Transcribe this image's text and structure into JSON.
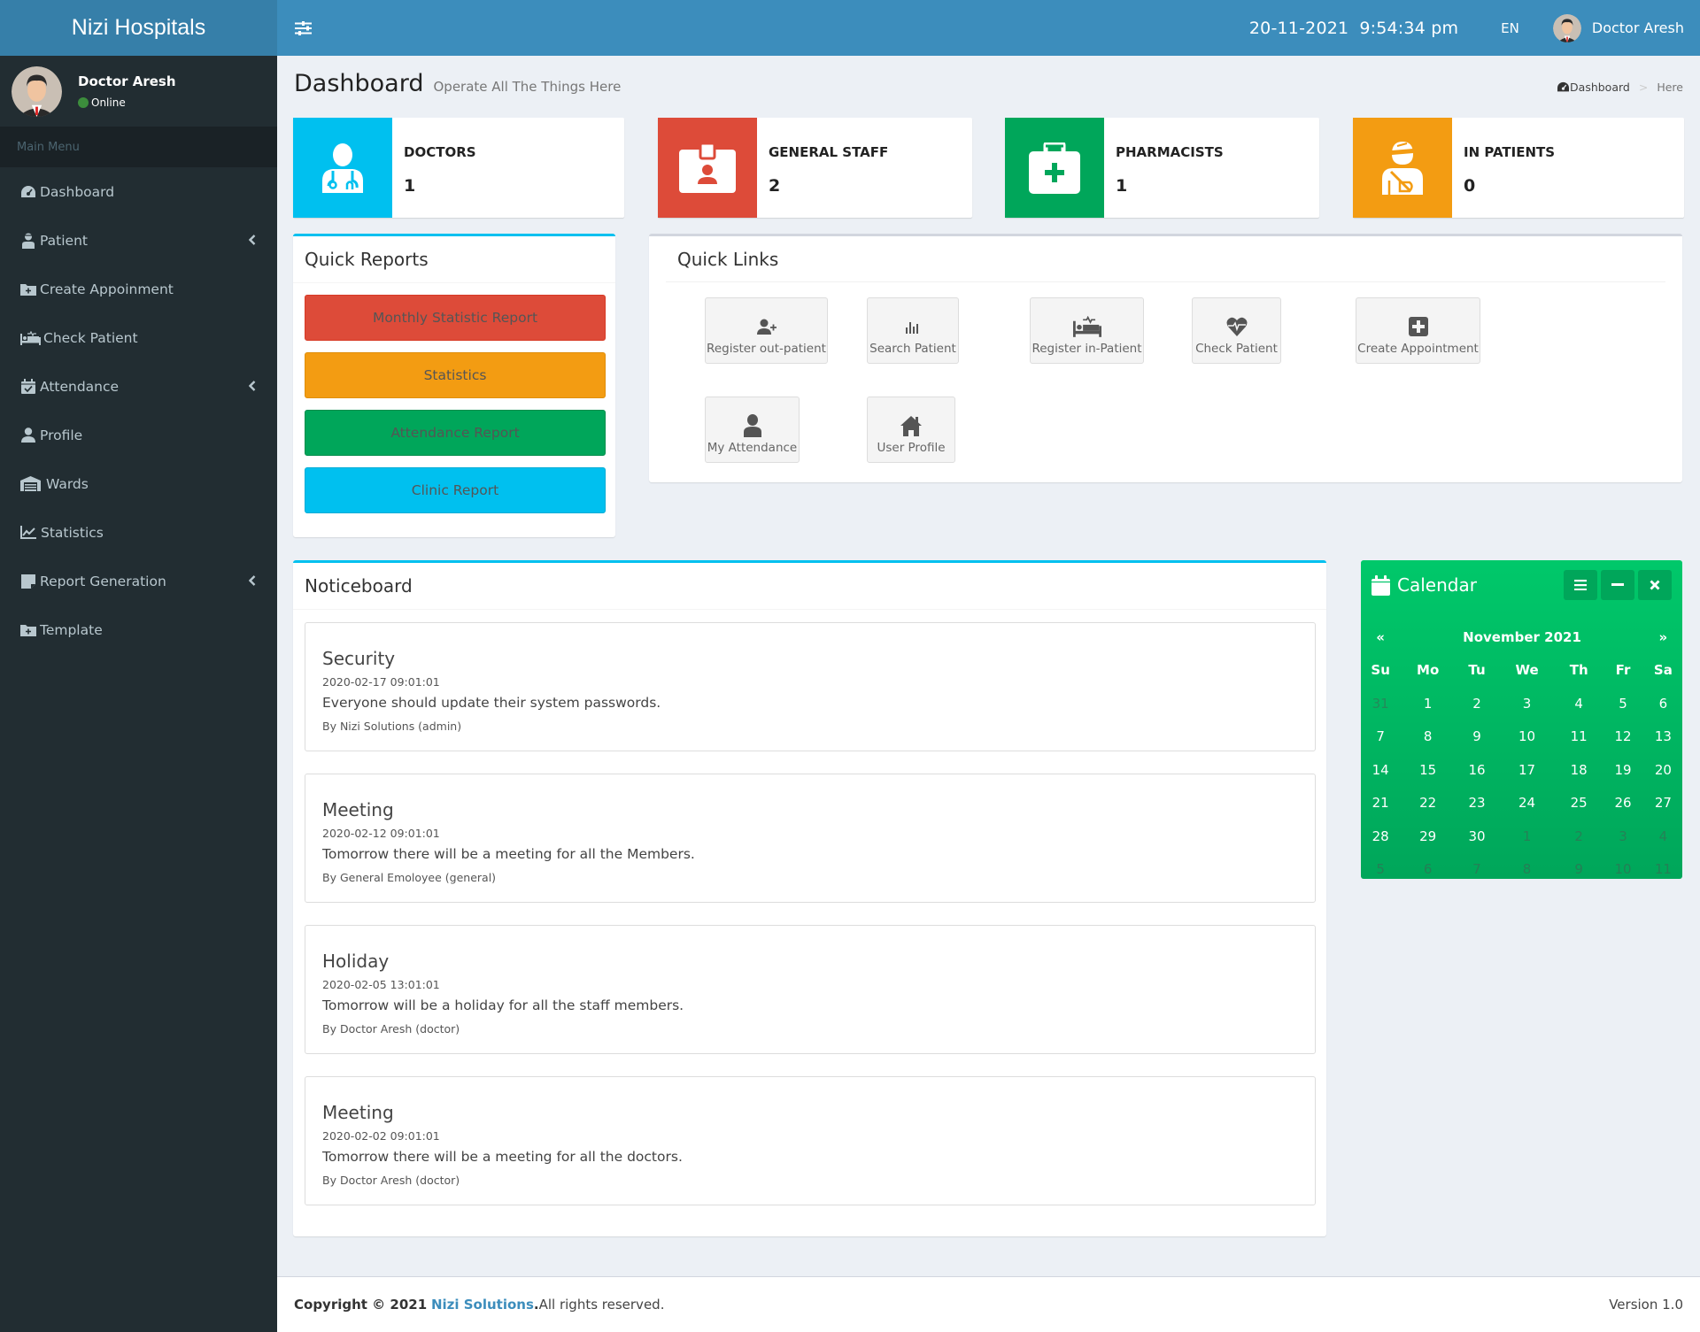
{
  "app": {
    "title": "Nizi Hospitals"
  },
  "header": {
    "date": "20-11-2021",
    "time": "9:54:34 pm",
    "language": "EN",
    "user_name": "Doctor Aresh"
  },
  "sidebar": {
    "user_name": "Doctor Aresh",
    "status": "Online",
    "menu_header": "Main Menu",
    "items": [
      {
        "label": "Dashboard",
        "icon": "dashboard-icon",
        "has_submenu": false
      },
      {
        "label": "Patient",
        "icon": "patient-icon",
        "has_submenu": true
      },
      {
        "label": "Create Appoinment",
        "icon": "folder-plus-icon",
        "has_submenu": false
      },
      {
        "label": "Check Patient",
        "icon": "bed-pulse-icon",
        "has_submenu": false
      },
      {
        "label": "Attendance",
        "icon": "calendar-check-icon",
        "has_submenu": true
      },
      {
        "label": "Profile",
        "icon": "user-icon",
        "has_submenu": false
      },
      {
        "label": "Wards",
        "icon": "warehouse-icon",
        "has_submenu": false
      },
      {
        "label": "Statistics",
        "icon": "chart-line-icon",
        "has_submenu": false
      },
      {
        "label": "Report Generation",
        "icon": "sticky-note-icon",
        "has_submenu": true
      },
      {
        "label": "Template",
        "icon": "folder-plus-icon",
        "has_submenu": false
      }
    ]
  },
  "page": {
    "title": "Dashboard",
    "subtitle": "Operate All The Things Here",
    "breadcrumb": [
      "Dashboard",
      "Here"
    ],
    "breadcrumb_sep": ">"
  },
  "info_boxes": [
    {
      "label": "DOCTORS",
      "value": "1",
      "color": "#00c0ef",
      "icon": "doctor-icon"
    },
    {
      "label": "GENERAL STAFF",
      "value": "2",
      "color": "#dd4b39",
      "icon": "id-badge-icon"
    },
    {
      "label": "PHARMACISTS",
      "value": "1",
      "color": "#00a65a",
      "icon": "medkit-icon"
    },
    {
      "label": "IN PATIENTS",
      "value": "0",
      "color": "#f39c12",
      "icon": "injured-icon"
    }
  ],
  "quick_reports": {
    "title": "Quick Reports",
    "buttons": [
      {
        "label": "Monthly Statistic Report",
        "color": "#dd4b39"
      },
      {
        "label": "Statistics",
        "color": "#f39c12"
      },
      {
        "label": "Attendance Report",
        "color": "#00a65a"
      },
      {
        "label": "Clinic Report",
        "color": "#00c0ef"
      }
    ]
  },
  "quick_links": {
    "title": "Quick Links",
    "items": [
      {
        "label": "Register out-patient",
        "icon": "user-plus-icon"
      },
      {
        "label": "Search Patient",
        "icon": "bar-chart-icon"
      },
      {
        "label": "Register in-Patient",
        "icon": "bed-pulse-icon"
      },
      {
        "label": "Check Patient",
        "icon": "heartbeat-icon"
      },
      {
        "label": "Create Appointment",
        "icon": "plus-square-icon"
      },
      {
        "label": "My Attendance",
        "icon": "user-icon"
      },
      {
        "label": "User Profile",
        "icon": "home-icon"
      }
    ]
  },
  "noticeboard": {
    "title": "Noticeboard",
    "notices": [
      {
        "title": "Security",
        "date": "2020-02-17 09:01:01",
        "body": "Everyone should update their system passwords.",
        "by": "By Nizi Solutions (admin)"
      },
      {
        "title": "Meeting",
        "date": "2020-02-12 09:01:01",
        "body": "Tomorrow there will be a meeting for all the Members.",
        "by": "By General Emoloyee (general)"
      },
      {
        "title": "Holiday",
        "date": "2020-02-05 13:01:01",
        "body": "Tomorrow will be a holiday for all the staff members.",
        "by": "By Doctor Aresh (doctor)"
      },
      {
        "title": "Meeting",
        "date": "2020-02-02 09:01:01",
        "body": "Tomorrow there will be a meeting for all the doctors.",
        "by": "By Doctor Aresh (doctor)"
      }
    ]
  },
  "calendar": {
    "title": "Calendar",
    "month_label": "November 2021",
    "prev": "«",
    "next": "»",
    "weekdays": [
      "Su",
      "Mo",
      "Tu",
      "We",
      "Th",
      "Fr",
      "Sa"
    ],
    "weeks": [
      [
        {
          "d": "31",
          "o": true
        },
        {
          "d": "1"
        },
        {
          "d": "2"
        },
        {
          "d": "3"
        },
        {
          "d": "4"
        },
        {
          "d": "5"
        },
        {
          "d": "6"
        }
      ],
      [
        {
          "d": "7"
        },
        {
          "d": "8"
        },
        {
          "d": "9"
        },
        {
          "d": "10"
        },
        {
          "d": "11"
        },
        {
          "d": "12"
        },
        {
          "d": "13"
        }
      ],
      [
        {
          "d": "14"
        },
        {
          "d": "15"
        },
        {
          "d": "16"
        },
        {
          "d": "17"
        },
        {
          "d": "18"
        },
        {
          "d": "19"
        },
        {
          "d": "20"
        }
      ],
      [
        {
          "d": "21"
        },
        {
          "d": "22"
        },
        {
          "d": "23"
        },
        {
          "d": "24"
        },
        {
          "d": "25"
        },
        {
          "d": "26"
        },
        {
          "d": "27"
        }
      ],
      [
        {
          "d": "28"
        },
        {
          "d": "29"
        },
        {
          "d": "30"
        },
        {
          "d": "1",
          "o": true
        },
        {
          "d": "2",
          "o": true
        },
        {
          "d": "3",
          "o": true
        },
        {
          "d": "4",
          "o": true
        }
      ],
      [
        {
          "d": "5",
          "o": true
        },
        {
          "d": "6",
          "o": true
        },
        {
          "d": "7",
          "o": true
        },
        {
          "d": "8",
          "o": true
        },
        {
          "d": "9",
          "o": true
        },
        {
          "d": "10",
          "o": true
        },
        {
          "d": "11",
          "o": true
        }
      ]
    ]
  },
  "footer": {
    "copyright": "Copyright © 2021",
    "company": "Nizi Solutions",
    "rights": ". All rights reserved.",
    "version": "Version 1.0"
  }
}
